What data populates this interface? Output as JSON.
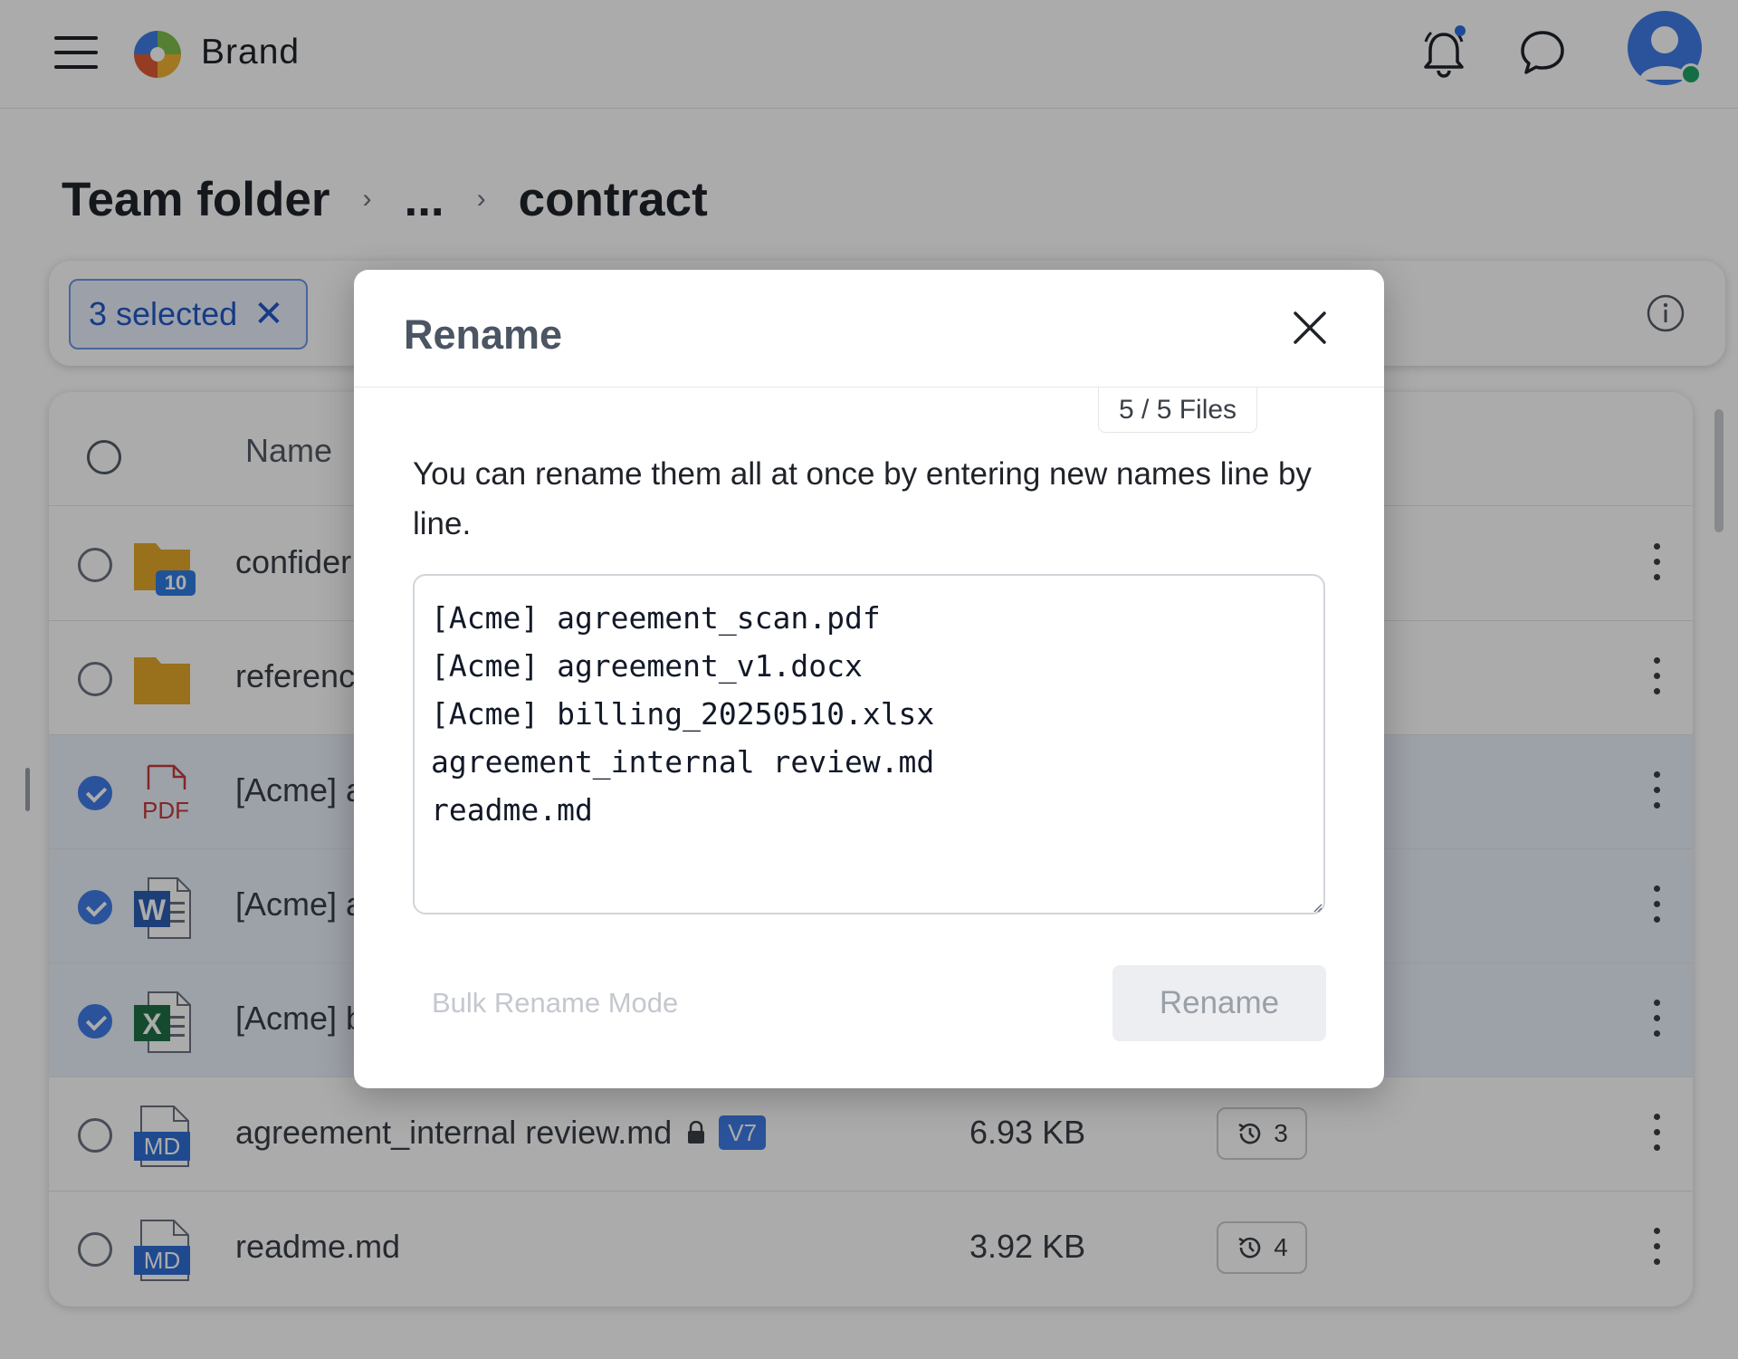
{
  "topbar": {
    "brand": "Brand",
    "icons": {
      "menu": "hamburger-icon",
      "logo": "puzzle-logo",
      "notifications": "bell-icon",
      "messages": "chat-bubble-icon",
      "profile": "user-avatar"
    },
    "colors": {
      "accent": "#3f7de8",
      "online": "#20a464",
      "notification_dot": "#2f6fe4"
    }
  },
  "breadcrumb": {
    "root": "Team folder",
    "ellipsis": "...",
    "current": "contract"
  },
  "toolbar": {
    "selected_label": "3 selected",
    "clear_icon": "close-icon",
    "info_icon": "info-icon"
  },
  "filelist": {
    "header": {
      "name_label": "Name"
    },
    "rows": [
      {
        "name": "confider",
        "type": "folder",
        "badge_count": "10",
        "selected": false
      },
      {
        "name": "referenc",
        "type": "folder",
        "selected": false
      },
      {
        "name": "[Acme] a",
        "type": "pdf",
        "icon_label": "PDF",
        "selected": true
      },
      {
        "name": "[Acme] a",
        "type": "docx",
        "icon_label": "W",
        "selected": true
      },
      {
        "name": "[Acme] b",
        "type": "xlsx",
        "icon_label": "X",
        "selected": true
      },
      {
        "name": "agreement_internal review.md",
        "type": "md",
        "icon_label": "MD",
        "locked": true,
        "version": "V7",
        "size": "6.93 KB",
        "history_count": "3",
        "selected": false
      },
      {
        "name": "readme.md",
        "type": "md",
        "icon_label": "MD",
        "size": "3.92 KB",
        "history_count": "4",
        "selected": false
      }
    ]
  },
  "dialog": {
    "title": "Rename",
    "files_count": "5 / 5 Files",
    "description": "You can rename them all at once by entering new names line by line.",
    "names_text": "[Acme] agreement_scan.pdf\n[Acme] agreement_v1.docx\n[Acme] billing_20250510.xlsx\nagreement_internal review.md\nreadme.md",
    "bulk_mode_label": "Bulk Rename Mode",
    "rename_label": "Rename"
  }
}
